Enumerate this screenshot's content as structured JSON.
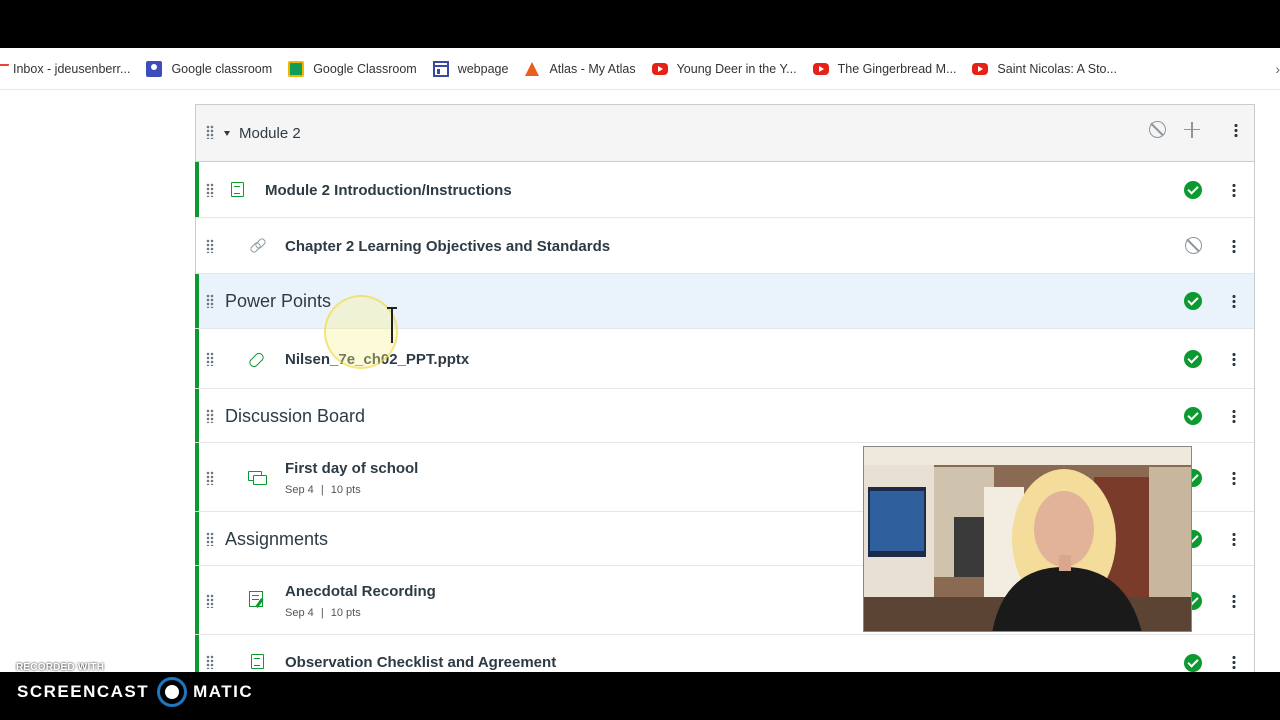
{
  "bookmarks": [
    {
      "label": "Inbox - jdeusenberr...",
      "icon": "gmail-icon"
    },
    {
      "label": "Google classroom",
      "icon": "google-classroom-icon"
    },
    {
      "label": "Google Classroom",
      "icon": "google-classroom-green-icon"
    },
    {
      "label": "webpage",
      "icon": "webpage-icon"
    },
    {
      "label": "Atlas - My Atlas",
      "icon": "atlas-icon"
    },
    {
      "label": "Young Deer in the Y...",
      "icon": "youtube-icon"
    },
    {
      "label": "The Gingerbread M...",
      "icon": "youtube-icon"
    },
    {
      "label": "Saint Nicolas: A Sto...",
      "icon": "youtube-icon"
    }
  ],
  "module": {
    "title": "Module 2",
    "items": [
      {
        "kind": "item",
        "title": "Module 2 Introduction/Instructions",
        "icon": "page-icon",
        "published": true
      },
      {
        "kind": "item",
        "title": "Chapter 2 Learning Objectives and Standards",
        "icon": "link-icon",
        "published": false
      },
      {
        "kind": "header",
        "title": "Power Points",
        "published": true
      },
      {
        "kind": "item",
        "title": "Nilsen_7e_ch02_PPT.pptx",
        "icon": "attachment-icon",
        "published": true
      },
      {
        "kind": "header",
        "title": "Discussion Board",
        "published": true
      },
      {
        "kind": "item",
        "title": "First day of school",
        "icon": "discussion-icon",
        "published": true,
        "date": "Sep 4",
        "points": "10 pts"
      },
      {
        "kind": "header",
        "title": "Assignments",
        "published": true
      },
      {
        "kind": "item",
        "title": "Anecdotal Recording",
        "icon": "assignment-icon",
        "published": true,
        "date": "Sep 4",
        "points": "10 pts"
      },
      {
        "kind": "item",
        "title": "Observation Checklist and Agreement",
        "icon": "page-icon",
        "published": true
      }
    ]
  },
  "meta_separator": "|",
  "recorder": {
    "recorded_with": "RECORDED WITH",
    "brand_left": "SCREENCAST",
    "brand_right": "MATIC"
  },
  "colors": {
    "published_green": "#0b9a2f",
    "text_dark": "#2d3b45",
    "highlight_blue": "#eaf3fb"
  }
}
